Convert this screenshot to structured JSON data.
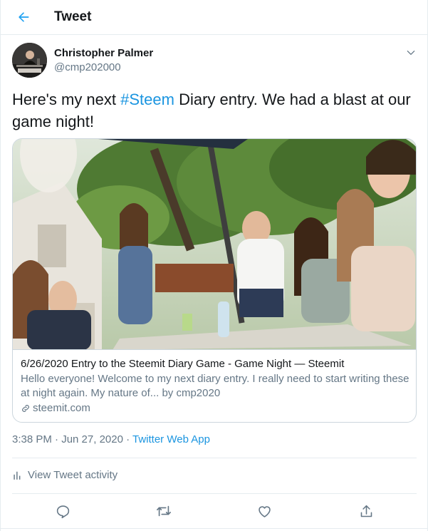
{
  "header": {
    "title": "Tweet",
    "back_icon": "arrow-left-icon",
    "accent_color": "#1da1f2"
  },
  "tweet": {
    "author": {
      "name": "Christopher Palmer",
      "handle": "@cmp202000",
      "avatar": "profile-photo"
    },
    "text_before": "Here's my next ",
    "hashtag": "#Steem",
    "text_after": " Diary entry. We had a blast at our game night!",
    "card": {
      "title": "6/26/2020 Entry to the Steemit Diary Game - Game Night — Steemit",
      "description": "Hello everyone! Welcome to my next diary entry. I really need to start writing these at night again. My nature of... by cmp2020",
      "domain": "steemit.com",
      "image_desc": "group-photo-outdoor"
    },
    "time": "3:38 PM · Jun 27, 2020 · ",
    "source": "Twitter Web App",
    "activity_label": "View Tweet activity"
  },
  "actions": {
    "reply_icon": "reply-icon",
    "retweet_icon": "retweet-icon",
    "like_icon": "heart-icon",
    "share_icon": "share-icon"
  },
  "colors": {
    "text_primary": "#14171a",
    "text_secondary": "#657786",
    "link": "#1b95e0",
    "border": "#e6ecf0"
  }
}
